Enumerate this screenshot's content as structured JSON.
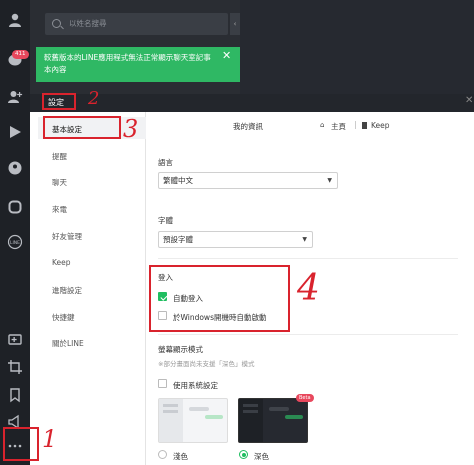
{
  "rail": {
    "badge": "411",
    "icons": [
      "person-icon",
      "chat-icon",
      "add-friend-icon",
      "play-icon",
      "timeline-icon",
      "square-icon",
      "line-circle-icon",
      "video-call-icon",
      "crop-icon",
      "bookmark-icon",
      "megaphone-icon",
      "more-icon"
    ]
  },
  "chatlist": {
    "search_placeholder": "以姓名搜尋",
    "notice": "較舊版本的LINE應用程式無法正常顯示聊天室記事本內容",
    "notice_close": "✕"
  },
  "settings": {
    "title": "設定",
    "close": "✕",
    "breadcrumb": {
      "title": "我的資訊",
      "home": "主頁",
      "keep": "Keep"
    },
    "sidebar": [
      "基本設定",
      "提醒",
      "聊天",
      "來電",
      "好友管理",
      "Keep",
      "進階設定",
      "快捷鍵",
      "關於LINE"
    ],
    "language": {
      "label": "語言",
      "value": "繁體中文"
    },
    "font": {
      "label": "字體",
      "value": "預設字體"
    },
    "login": {
      "label": "登入",
      "auto_login": "自動登入",
      "auto_login_checked": true,
      "startup": "於Windows開機時自動啟動",
      "startup_checked": false
    },
    "display_mode": {
      "label": "螢幕顯示模式",
      "note": "※部分畫面尚未支援「深色」模式",
      "use_system": "使用系統設定",
      "use_system_checked": false,
      "light_label": "淺色",
      "dark_label": "深色",
      "beta": "Beta",
      "selected": "dark"
    }
  },
  "annotations": [
    "1",
    "2",
    "3",
    "4"
  ],
  "colors": {
    "line_green": "#2fb864",
    "annotation_red": "#d9232d",
    "rail_bg": "#1e2126"
  }
}
